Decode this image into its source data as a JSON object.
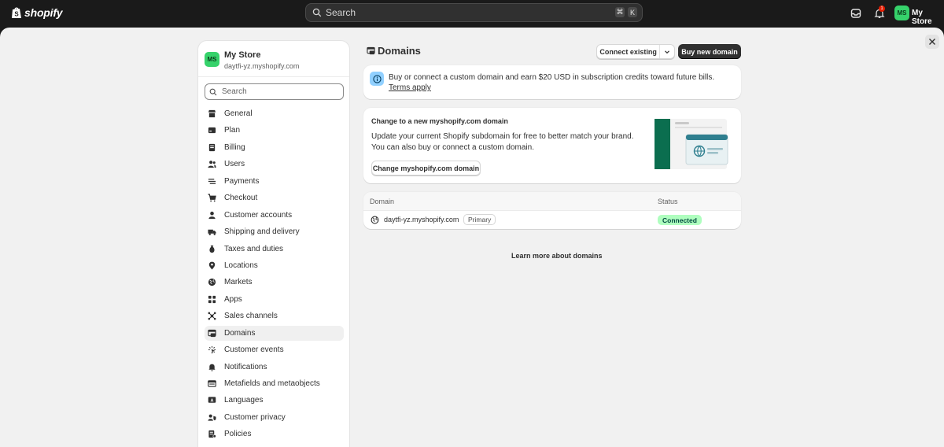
{
  "topbar": {
    "brand": "shopify",
    "search_placeholder": "Search",
    "shortcut_keys": [
      "⌘",
      "K"
    ],
    "notification_count": "1",
    "store_initials": "MS",
    "store_name": "My Store"
  },
  "sidebar": {
    "store_initials": "MS",
    "store_name": "My Store",
    "store_url": "daytfi-yz.myshopify.com",
    "search_placeholder": "Search",
    "items": [
      {
        "label": "General",
        "icon": "store-icon"
      },
      {
        "label": "Plan",
        "icon": "plan-icon"
      },
      {
        "label": "Billing",
        "icon": "billing-icon"
      },
      {
        "label": "Users",
        "icon": "users-icon"
      },
      {
        "label": "Payments",
        "icon": "payments-icon"
      },
      {
        "label": "Checkout",
        "icon": "cart-icon"
      },
      {
        "label": "Customer accounts",
        "icon": "person-icon"
      },
      {
        "label": "Shipping and delivery",
        "icon": "truck-icon"
      },
      {
        "label": "Taxes and duties",
        "icon": "tax-icon"
      },
      {
        "label": "Locations",
        "icon": "location-icon"
      },
      {
        "label": "Markets",
        "icon": "globe-icon"
      },
      {
        "label": "Apps",
        "icon": "apps-icon"
      },
      {
        "label": "Sales channels",
        "icon": "channels-icon"
      },
      {
        "label": "Domains",
        "icon": "domain-icon",
        "active": true
      },
      {
        "label": "Customer events",
        "icon": "events-icon"
      },
      {
        "label": "Notifications",
        "icon": "bell-icon"
      },
      {
        "label": "Metafields and metaobjects",
        "icon": "metafields-icon"
      },
      {
        "label": "Languages",
        "icon": "language-icon"
      },
      {
        "label": "Customer privacy",
        "icon": "privacy-icon"
      },
      {
        "label": "Policies",
        "icon": "policies-icon"
      }
    ]
  },
  "main": {
    "title": "Domains",
    "connect_existing_label": "Connect existing",
    "buy_new_label": "Buy new domain",
    "banner": {
      "text": "Buy or connect a custom domain and earn $20 USD in subscription credits toward future bills.",
      "link": "Terms apply"
    },
    "change_card": {
      "title": "Change to a new myshopify.com domain",
      "desc_line1": "Update your current Shopify subdomain for free to better match your brand.",
      "desc_line2": "You can also buy or connect a custom domain.",
      "button": "Change myshopify.com domain"
    },
    "table": {
      "col_domain": "Domain",
      "col_status": "Status",
      "rows": [
        {
          "domain": "daytfi-yz.myshopify.com",
          "badge": "Primary",
          "status": "Connected"
        }
      ]
    },
    "learn_more": "Learn more about domains"
  },
  "colors": {
    "accent_green": "#36d26b",
    "status_connected_bg": "#affebf",
    "banner_icon_bg": "#91d0ff",
    "topbar_bg": "#1a1a1a"
  }
}
